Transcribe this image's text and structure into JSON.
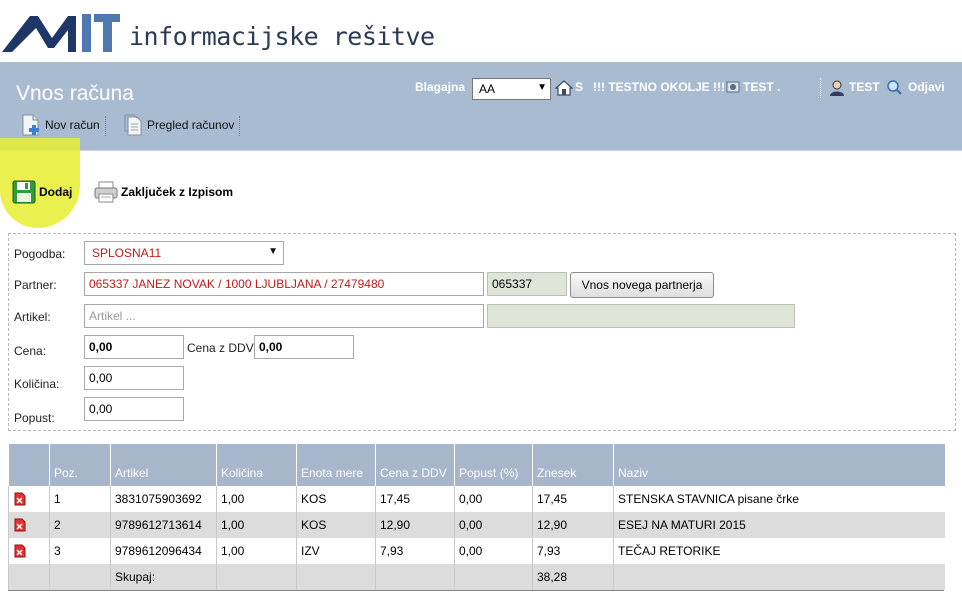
{
  "logo": {
    "mark_text": "MIT",
    "text": "informacijske rešitve"
  },
  "header": {
    "title": "Vnos računa",
    "nav": [
      {
        "label": "Nov račun",
        "icon": "new-document-icon"
      },
      {
        "label": "Pregled računov",
        "icon": "documents-icon"
      }
    ],
    "blagajna_label": "Blagajna",
    "blagajna_value": "AA",
    "home_label": "S",
    "env_label": "!!! TESTNO OKOLJE !!!",
    "company_label": "TEST .",
    "user_label": "TEST",
    "logout_label": "Odjavi"
  },
  "actions": {
    "add_label": "Dodaj",
    "close_label": "Zaključek z Izpisom"
  },
  "form": {
    "pogodba_label": "Pogodba:",
    "pogodba_value": "SPLOSNA11",
    "partner_label": "Partner:",
    "partner_value": "065337 JANEZ NOVAK / 1000   LJUBLJANA / 27479480",
    "partner_code": "065337",
    "partner_button": "Vnos novega partnerja",
    "artikel_label": "Artikel:",
    "artikel_placeholder": "Artikel ...",
    "cena_label": "Cena:",
    "cena_value": "0,00",
    "cena_ddv_label": "Cena z DDV:",
    "cena_ddv_value": "0,00",
    "kolicina_label": "Količina:",
    "kolicina_value": "0,00",
    "popust_label": "Popust:",
    "popust_value": "0,00"
  },
  "table": {
    "headers": [
      "",
      "Poz.",
      "Artikel",
      "Količina",
      "Enota mere",
      "Cena z DDV",
      "Popust (%)",
      "Znesek",
      "Naziv"
    ],
    "rows": [
      [
        "1",
        "3831075903692",
        "1,00",
        "KOS",
        "17,45",
        "0,00",
        "17,45",
        "STENSKA STAVNICA pisane črke"
      ],
      [
        "2",
        "9789612713614",
        "1,00",
        "KOS",
        "12,90",
        "0,00",
        "12,90",
        "ESEJ NA MATURI 2015"
      ],
      [
        "3",
        "9789612096434",
        "1,00",
        "IZV",
        "7,93",
        "0,00",
        "7,93",
        "TEČAJ RETORIKE"
      ]
    ],
    "sum_label": "Skupaj:",
    "sum_value": "38,28"
  },
  "colors": {
    "header_bg": "#a9bbd1",
    "highlight": "#e6ef2f",
    "required_text": "#c21a1a"
  }
}
